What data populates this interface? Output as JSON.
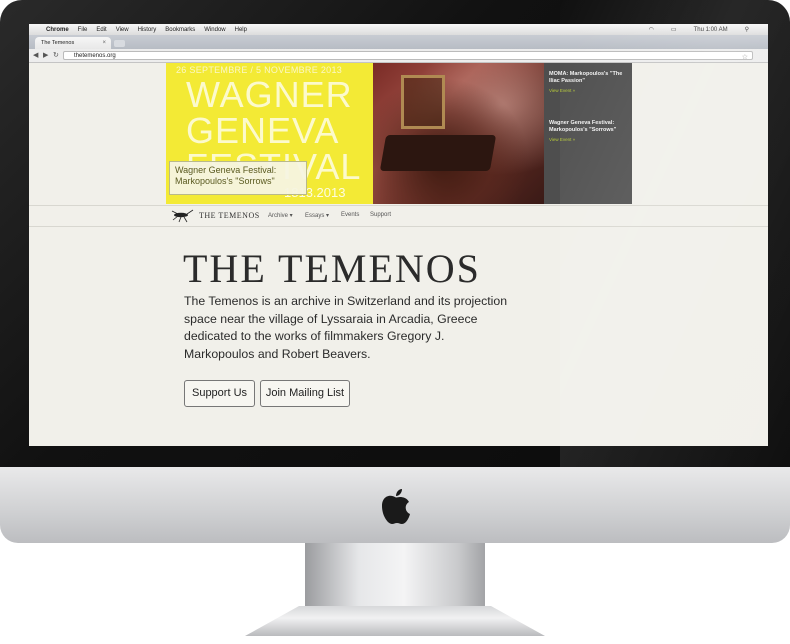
{
  "mac_menu": {
    "app": "Chrome",
    "items": [
      "File",
      "Edit",
      "View",
      "History",
      "Bookmarks",
      "Window",
      "Help"
    ],
    "clock": "Thu 1:00 AM"
  },
  "browser": {
    "tab_title": "The Temenos",
    "url": "thetemenos.org"
  },
  "hero": {
    "dates": "26 SEPTEMBRE / 5 NOVEMBRE 2013",
    "line1": "WAGNER",
    "line2": "GENEVA",
    "line3": "FESTIVAL",
    "years": "1813.2013",
    "caption_line1": "Wagner Geneva Festival:",
    "caption_line2": "Markopoulos's \"Sorrows\""
  },
  "news": [
    {
      "title": "MOMA: Markopoulos's \"The Iliac Passion\"",
      "link": "View Event »"
    },
    {
      "title": "Wagner Geneva Festival: Markopoulos's \"Sorrows\"",
      "link": "View Event »"
    }
  ],
  "site_nav": {
    "site_name": "THE TEMENOS",
    "archive": "Archive ▾",
    "essays": "Essays ▾",
    "events": "Events",
    "support": "Support"
  },
  "main": {
    "title": "THE TEMENOS",
    "intro": "The Temenos is an archive in Switzerland and its projection space near the village of Lyssaraia in Arcadia, Greece dedicated to the works of filmmakers Gregory J. Markopoulos and Robert Beavers.",
    "support_button": "Support Us",
    "mailing_button": "Join Mailing List"
  },
  "colors": {
    "hero_yellow": "#f3ea35",
    "news_bg": "#4e4e4e",
    "link_green": "#b6c93a",
    "page_bg": "#f1f0ea"
  },
  "icons": [
    "apple-icon",
    "wifi-icon",
    "battery-icon",
    "back-arrow-icon",
    "forward-arrow-icon",
    "reload-icon",
    "bookmark-star-icon",
    "close-tab-icon",
    "insect-logo-icon"
  ]
}
